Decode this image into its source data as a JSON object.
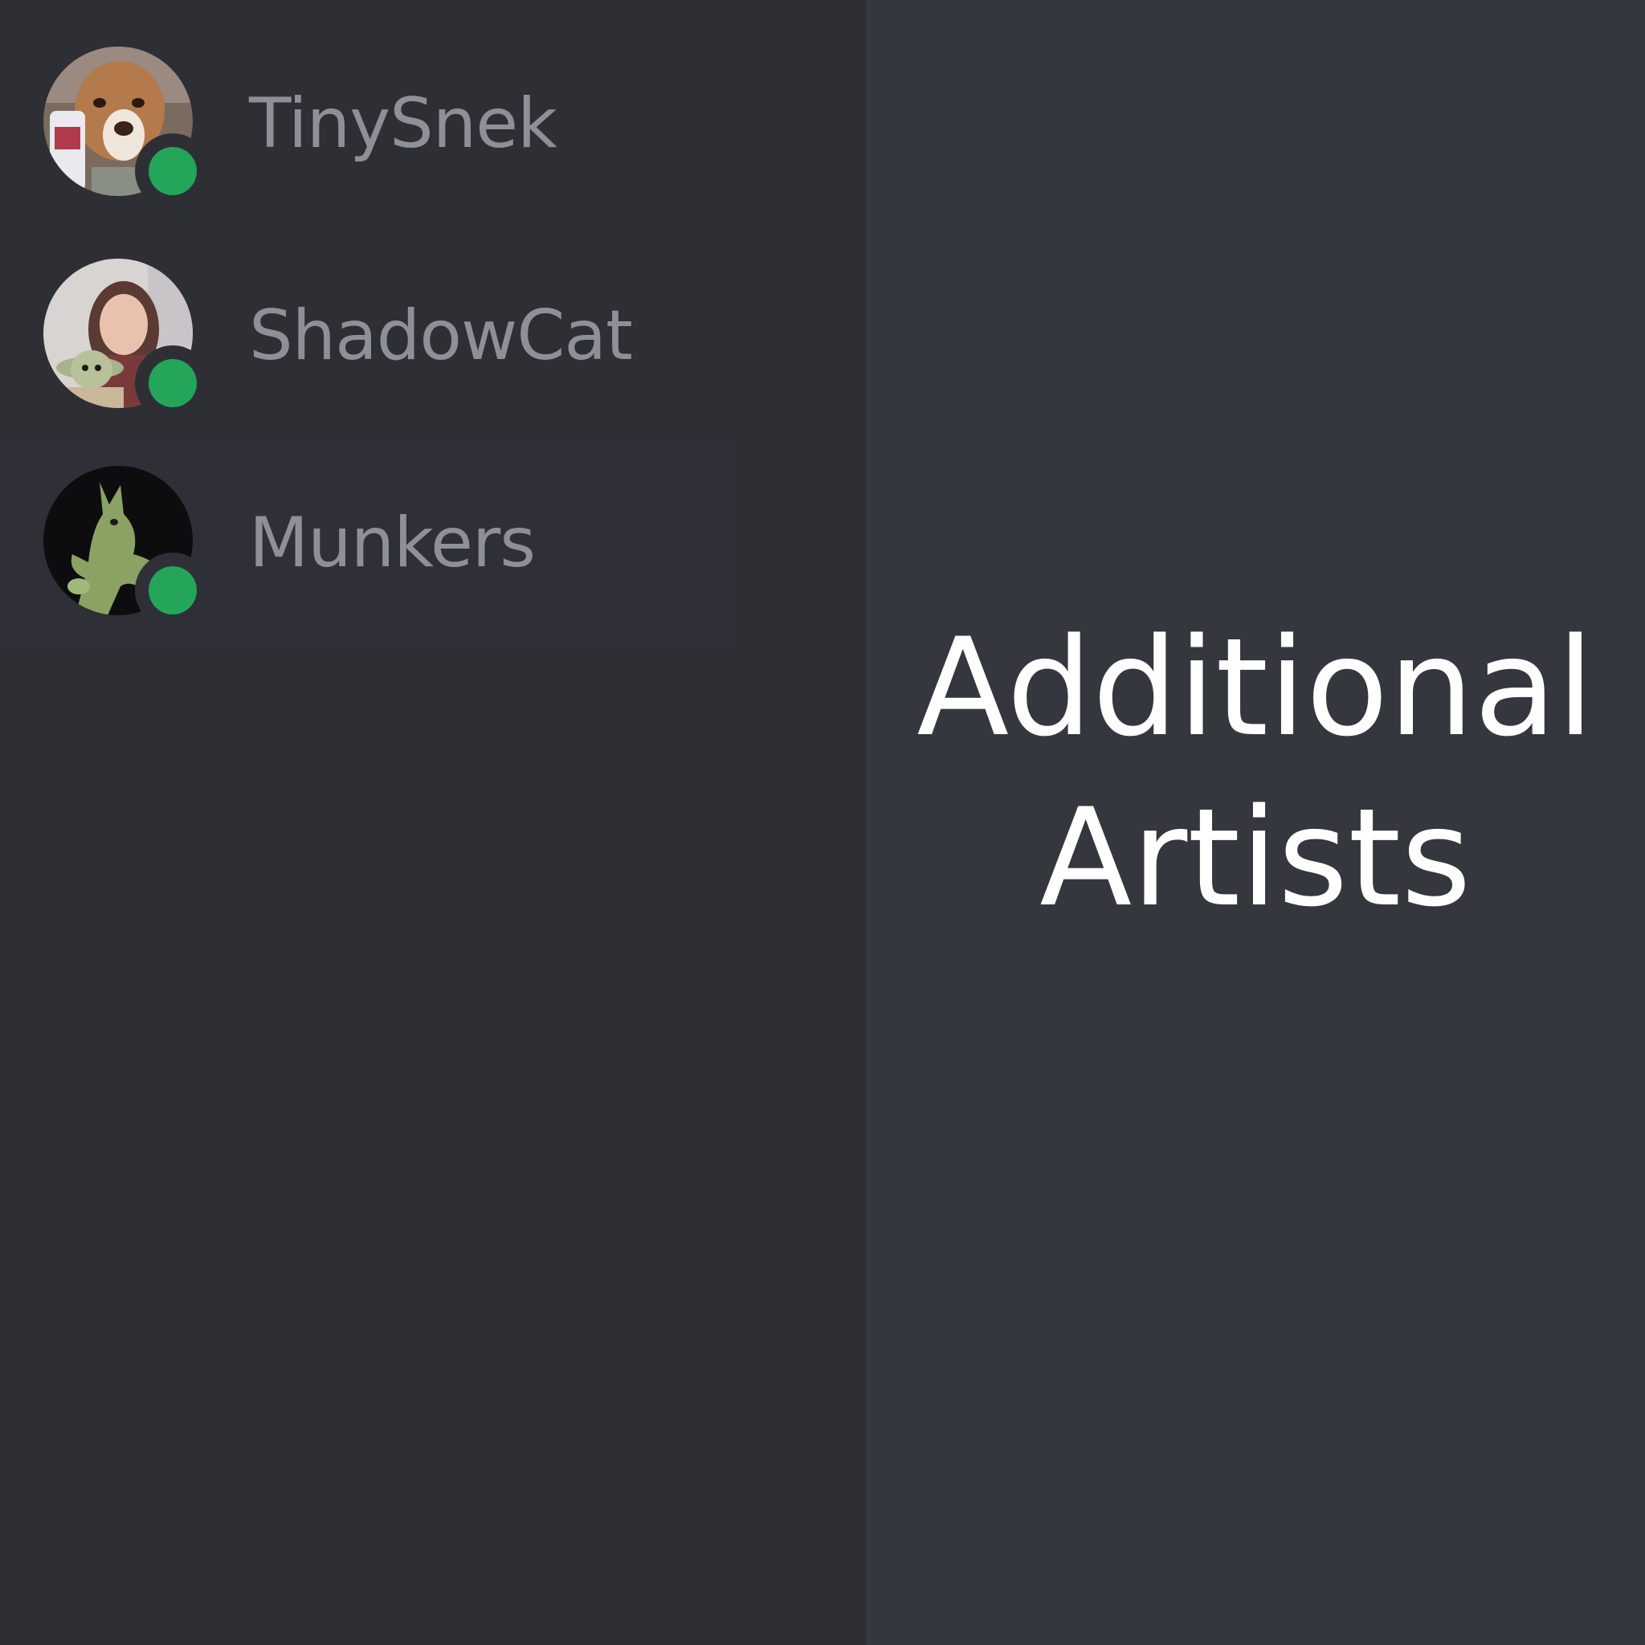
{
  "members": [
    {
      "name": "TinySnek",
      "avatar": "dog-photo-avatar",
      "status": "online"
    },
    {
      "name": "ShadowCat",
      "avatar": "person-with-baby-yoda-avatar",
      "status": "online"
    },
    {
      "name": "Munkers",
      "avatar": "green-dragon-figure-avatar",
      "status": "online"
    }
  ],
  "heading": {
    "line1": "Additional",
    "line2": "Artists"
  },
  "colors": {
    "member_panel_bg": "#2e2f35",
    "main_bg": "#35373f",
    "online": "#23a55a",
    "name_text": "#8e9097",
    "heading_text": "#ffffff"
  }
}
